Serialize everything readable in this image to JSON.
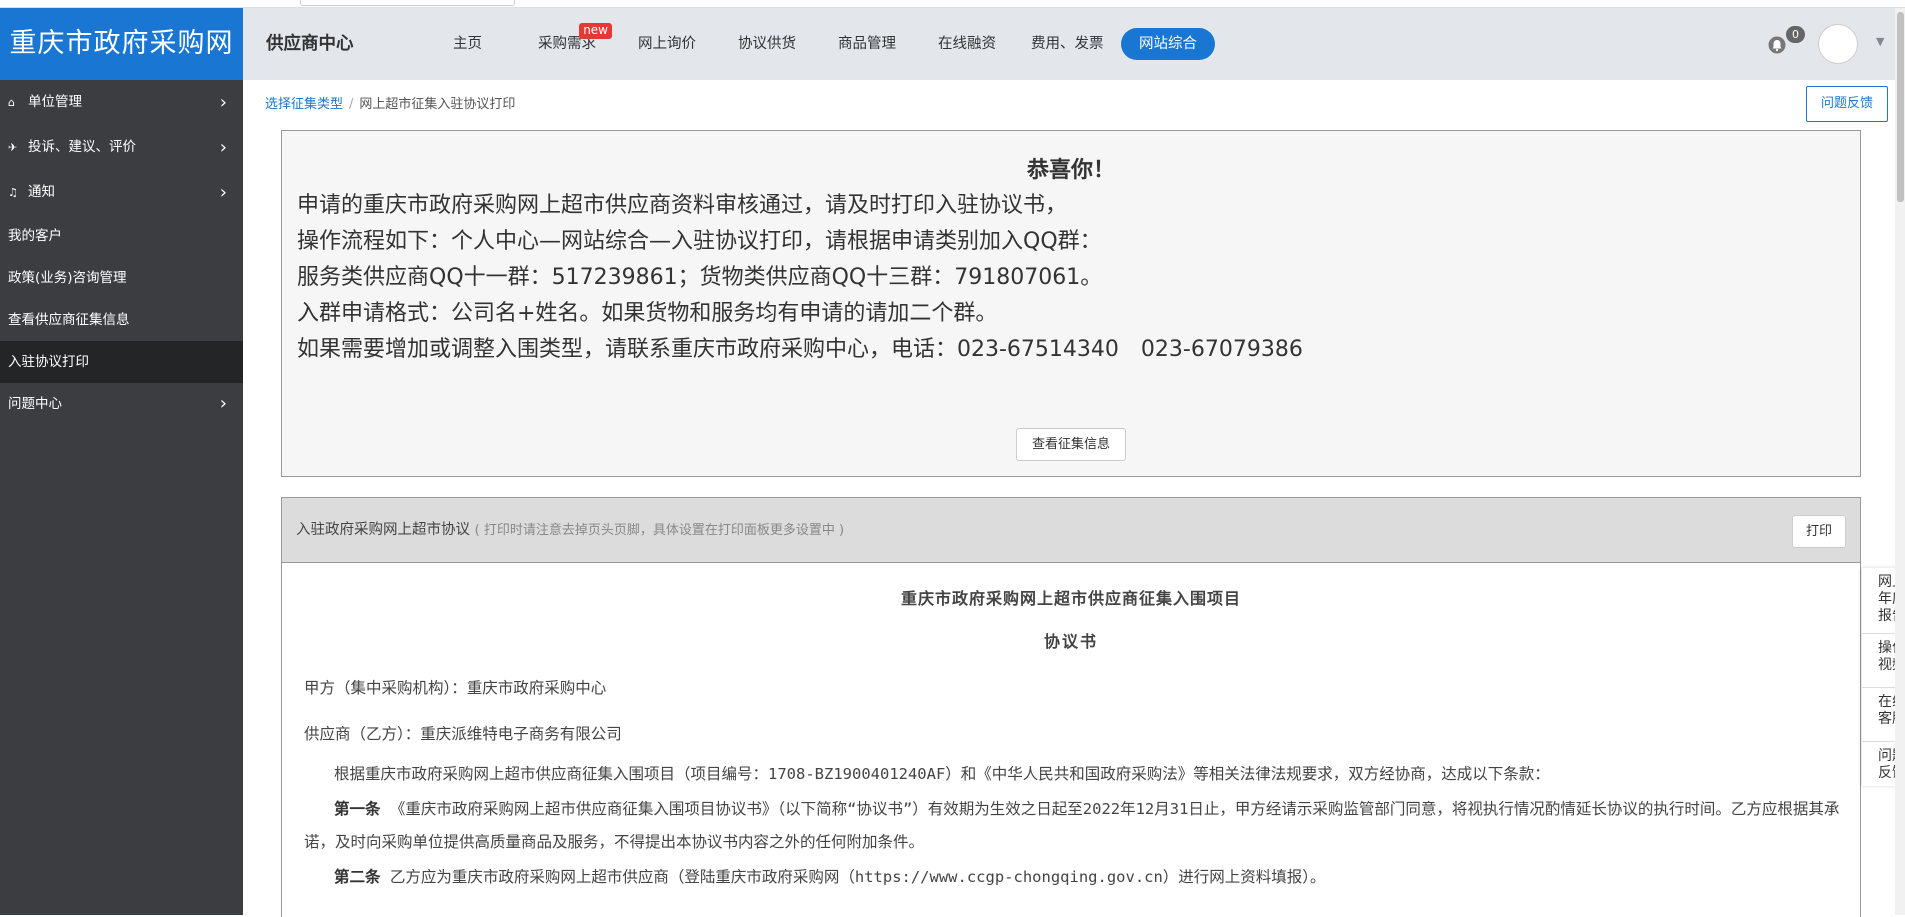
{
  "site": {
    "logo": "重庆市政府采购网",
    "center_title": "供应商中心"
  },
  "topnav": {
    "items": [
      {
        "label": "主页"
      },
      {
        "label": "采购需求",
        "badge": "new"
      },
      {
        "label": "网上询价"
      },
      {
        "label": "协议供货"
      },
      {
        "label": "商品管理"
      },
      {
        "label": "在线融资"
      },
      {
        "label": "费用、发票"
      },
      {
        "label": "网站综合",
        "active": true
      }
    ],
    "notification_count": "0"
  },
  "sidebar": {
    "items": [
      {
        "label": "单位管理",
        "icon": "building-icon",
        "has_children": true
      },
      {
        "label": "投诉、建议、评价",
        "icon": "send-icon",
        "has_children": true
      },
      {
        "label": "通知",
        "icon": "bell-icon",
        "has_children": true
      },
      {
        "label": "我的客户"
      },
      {
        "label": "政策(业务)咨询管理"
      },
      {
        "label": "查看供应商征集信息"
      },
      {
        "label": "入驻协议打印",
        "active": true
      },
      {
        "label": "问题中心",
        "has_children": true
      }
    ]
  },
  "breadcrumb": {
    "link": "选择征集类型",
    "separator": "/",
    "current": "网上超市征集入驻协议打印"
  },
  "feedback_label": "问题反馈",
  "notice": {
    "title": "恭喜你！",
    "lines": [
      "申请的重庆市政府采购网上超市供应商资料审核通过，请及时打印入驻协议书，",
      "操作流程如下：个人中心—网站综合—入驻协议打印，请根据申请类别加入QQ群：",
      "服务类供应商QQ十一群：517239861；货物类供应商QQ十三群：791807061。",
      "入群申请格式：公司名+姓名。如果货物和服务均有申请的请加二个群。",
      "如果需要增加或调整入围类型，请联系重庆市政府采购中心，电话：023-67514340　023-67079386"
    ],
    "button": "查看征集信息"
  },
  "agreement_panel": {
    "title": "入驻政府采购网上超市协议",
    "hint": "( 打印时请注意去掉页头页脚，具体设置在打印面板更多设置中 )",
    "print_button": "打印",
    "doc": {
      "title": "重庆市政府采购网上超市供应商征集入围项目",
      "subtitle": "协议书",
      "party_a": "甲方（集中采购机构）：重庆市政府采购中心",
      "party_b": "供应商（乙方）：重庆派维特电子商务有限公司",
      "intro": "根据重庆市政府采购网上超市供应商征集入围项目（项目编号：1708-BZ1900401240AF）和《中华人民共和国政府采购法》等相关法律法规要求，双方经协商，达成以下条款：",
      "article1_label": "第一条",
      "article1": "《重庆市政府采购网上超市供应商征集入围项目协议书》（以下简称“协议书”）有效期为生效之日起至2022年12月31日止，甲方经请示采购监管部门同意，将视执行情况酌情延长协议的执行时间。乙方应根据其承诺，及时向采购单位提供高质量商品及服务，不得提出本协议书内容之外的任何附加条件。",
      "article2_label": "第二条",
      "article2": "乙方应为重庆市政府采购网上超市供应商（登陆重庆市政府采购网（https://www.ccgp-chongqing.gov.cn）进行网上资料填报）。"
    }
  },
  "float_tab": {
    "items": [
      {
        "line1": "网上",
        "line2": "年度",
        "line3": "报告"
      },
      {
        "line1": "操作",
        "line2": "视频"
      },
      {
        "line1": "在线",
        "line2": "客服"
      },
      {
        "line1": "问题",
        "line2": "反馈"
      }
    ]
  }
}
